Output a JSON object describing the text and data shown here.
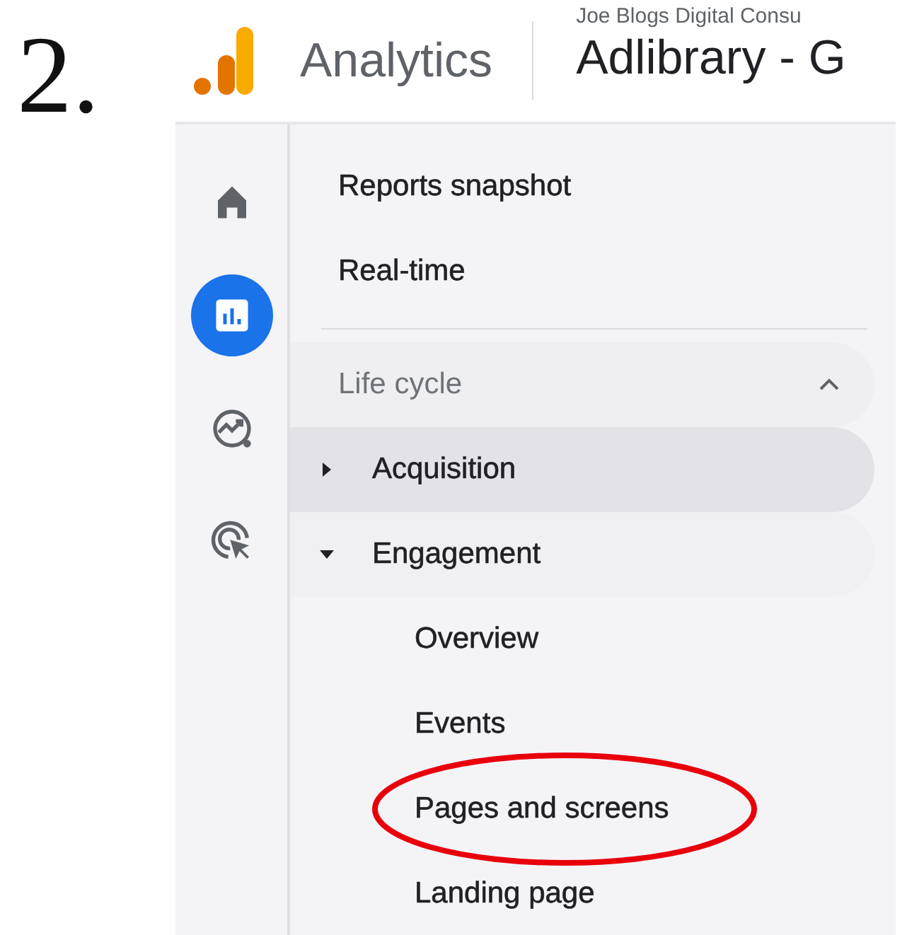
{
  "step_label": "2.",
  "header": {
    "product": "Analytics",
    "account": "Joe Blogs Digital Consu",
    "property": "Adlibrary - G"
  },
  "rail": [
    {
      "kind": "home",
      "selected": false
    },
    {
      "kind": "reports",
      "selected": true
    },
    {
      "kind": "explore",
      "selected": false
    },
    {
      "kind": "advertising",
      "selected": false
    }
  ],
  "nav": {
    "top_items": [
      "Reports snapshot",
      "Real-time"
    ],
    "section": {
      "label": "Life cycle",
      "expanded": true,
      "groups": [
        {
          "label": "Acquisition",
          "expanded": false,
          "hovered": true
        },
        {
          "label": "Engagement",
          "expanded": true,
          "hovered": false,
          "children": [
            {
              "label": "Overview",
              "circled": false
            },
            {
              "label": "Events",
              "circled": false
            },
            {
              "label": "Pages and screens",
              "circled": true
            },
            {
              "label": "Landing page",
              "circled": false
            }
          ]
        }
      ]
    }
  }
}
